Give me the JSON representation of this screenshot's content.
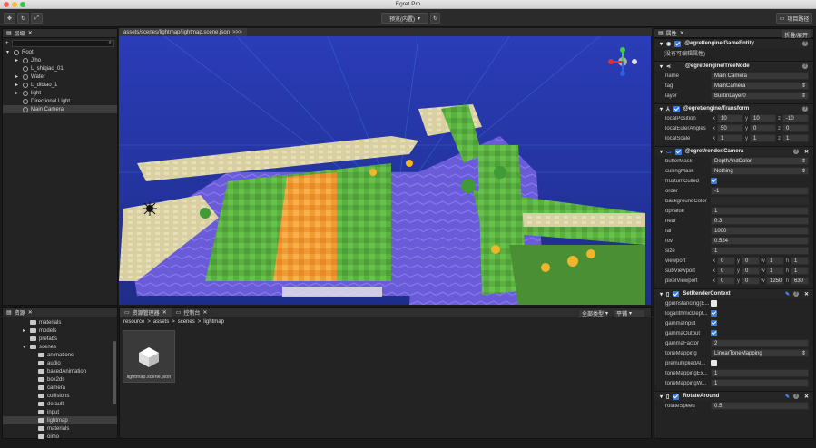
{
  "window": {
    "title": "Egret Pro"
  },
  "toolbar": {
    "preview_label": "预览(内置)",
    "project_path_label": "项目路径"
  },
  "hierarchy": {
    "tab": "层级",
    "items": [
      {
        "label": "Root",
        "indent": 0,
        "expander": true
      },
      {
        "label": "Jiho",
        "indent": 1,
        "expander": true
      },
      {
        "label": "L_shiqiao_01",
        "indent": 1,
        "expander": false
      },
      {
        "label": "Water",
        "indent": 1,
        "expander": true
      },
      {
        "label": "L_dibiao_1",
        "indent": 1,
        "expander": true
      },
      {
        "label": "light",
        "indent": 1,
        "expander": true
      },
      {
        "label": "Directional Light",
        "indent": 1,
        "expander": false
      },
      {
        "label": "Main Camera",
        "indent": 1,
        "expander": false,
        "selected": true
      }
    ]
  },
  "scene_tab": {
    "label": "assets/scenes/lightmap/lightmap.scene.json",
    "more": ">>>"
  },
  "assets": {
    "tab": "资源",
    "items": [
      {
        "label": "materials",
        "indent": 2
      },
      {
        "label": "models",
        "indent": 2,
        "expander": true
      },
      {
        "label": "prefabs",
        "indent": 2
      },
      {
        "label": "scenes",
        "indent": 2,
        "expander": true,
        "open": true
      },
      {
        "label": "animations",
        "indent": 3
      },
      {
        "label": "audio",
        "indent": 3
      },
      {
        "label": "bakedAnimation",
        "indent": 3
      },
      {
        "label": "box2ds",
        "indent": 3
      },
      {
        "label": "camera",
        "indent": 3
      },
      {
        "label": "collisions",
        "indent": 3
      },
      {
        "label": "default",
        "indent": 3
      },
      {
        "label": "input",
        "indent": 3
      },
      {
        "label": "lightmap",
        "indent": 3,
        "selected": true
      },
      {
        "label": "materials",
        "indent": 3
      },
      {
        "label": "oimo",
        "indent": 3
      }
    ]
  },
  "explorer": {
    "tabs": [
      "资源管理器",
      "控制台"
    ],
    "filter_type": "全部类型",
    "view_mode": "平铺",
    "breadcrumb": [
      "resource",
      "assets",
      "scenes",
      "lightmap"
    ],
    "files": [
      {
        "label": "lightmap.scene.json"
      }
    ]
  },
  "inspector": {
    "tab": "属性",
    "collapse_label": "折叠/展开",
    "game_entity": {
      "title": "@egret/engine/GameEntity",
      "note": "(没有可编辑属性)"
    },
    "tree_node": {
      "title": "@egret/engine/TreeNode",
      "name_label": "name",
      "name_value": "Main Camera",
      "tag_label": "tag",
      "tag_value": "MainCamera",
      "layer_label": "layer",
      "layer_value": "BuiltinLayer0"
    },
    "transform": {
      "title": "@egret/engine/Transform",
      "rows": [
        {
          "label": "localPosition",
          "x": "10",
          "y": "10",
          "z": "-10"
        },
        {
          "label": "localEulerAngles",
          "x": "50",
          "y": "0",
          "z": "0"
        },
        {
          "label": "localScale",
          "x": "1",
          "y": "1",
          "z": "1"
        }
      ]
    },
    "camera": {
      "title": "@egret/render/Camera",
      "bufferMask_label": "bufferMask",
      "bufferMask_value": "DepthAndColor",
      "cullingMask_label": "cullingMask",
      "cullingMask_value": "Nothing",
      "frustumCulled_label": "frustumCulled",
      "order_label": "order",
      "order_value": "-1",
      "backgroundColor_label": "backgroundColor",
      "opvalue_label": "opvalue",
      "opvalue_value": "1",
      "near_label": "near",
      "near_value": "0.3",
      "far_label": "far",
      "far_value": "1000",
      "fov_label": "fov",
      "fov_value": "0.524",
      "size_label": "size",
      "size_value": "1",
      "viewport": {
        "label": "viewport",
        "x": "0",
        "y": "0",
        "w": "1",
        "h": "1"
      },
      "subViewport": {
        "label": "subViewport",
        "x": "0",
        "y": "0",
        "w": "1",
        "h": "1"
      },
      "pixelViewport": {
        "label": "pixelViewport",
        "x": "0",
        "y": "0",
        "w": "1250",
        "h": "630"
      }
    },
    "render_context": {
      "title": "SetRenderContext",
      "gpuInstancing_label": "gpuInstancing(E...",
      "logarithmicDepth_label": "logarithmicDept...",
      "gammaInput_label": "gammaInput",
      "gammaOutput_label": "gammaOutput",
      "gammaFactor_label": "gammaFactor",
      "gammaFactor_value": "2",
      "toneMapping_label": "toneMapping",
      "toneMapping_value": "LinearToneMapping",
      "premultipliedAlpha_label": "premultipliedAl...",
      "toneMappingExposure_label": "toneMappingEx...",
      "toneMappingExposure_value": "1",
      "toneMappingWhite_label": "toneMappingW...",
      "toneMappingWhite_value": "1"
    },
    "rotate_around": {
      "title": "RotateAround",
      "rotateSpeed_label": "rotateSpeed",
      "rotateSpeed_value": "0.5"
    }
  },
  "colors": {
    "accent": "#3a7be0",
    "panel": "#232323",
    "sky": "#2a3fb0",
    "grass": "#5fb443",
    "lava": "#f0a03c",
    "water": "#6a5cd8"
  }
}
